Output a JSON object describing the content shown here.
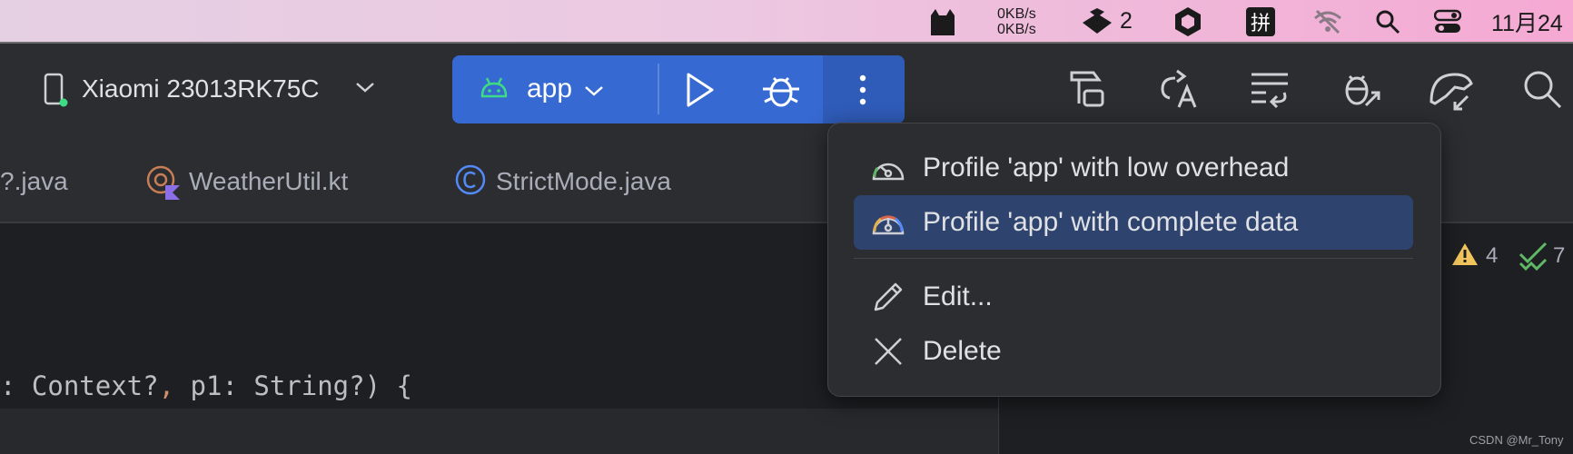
{
  "menubar": {
    "net_up": "0KB/s",
    "net_down": "0KB/s",
    "notif_count": "2",
    "input_method": "拼",
    "date": "11月24"
  },
  "toolbar": {
    "device_name": "Xiaomi 23013RK75C",
    "config_name": "app",
    "icons": [
      "device-icon",
      "chevron-down-icon",
      "android-icon",
      "run-icon",
      "debug-icon",
      "more-vertical-icon",
      "build-icon",
      "translate-icon",
      "sync-icon",
      "attach-debugger-icon",
      "profiler-icon",
      "search-icon"
    ]
  },
  "tabs": [
    {
      "label": "?.java",
      "icon": "java-class-icon"
    },
    {
      "label": "WeatherUtil.kt",
      "icon": "kotlin-file-icon"
    },
    {
      "label": "StrictMode.java",
      "icon": "java-class-icon"
    }
  ],
  "editor": {
    "code_line_before": ": Context?",
    "code_comma": ",",
    "code_line_after": " p1: String?) {"
  },
  "inspections": {
    "warnings": "4",
    "checks": "7"
  },
  "popup": {
    "items": [
      {
        "label": "Profile 'app' with low overhead",
        "icon": "gauge-low-icon",
        "selected": false
      },
      {
        "label": "Profile 'app' with complete data",
        "icon": "gauge-full-icon",
        "selected": true
      },
      {
        "label": "Edit...",
        "icon": "pencil-icon",
        "selected": false
      },
      {
        "label": "Delete",
        "icon": "close-icon",
        "selected": false
      }
    ]
  },
  "watermark": "CSDN @Mr_Tony",
  "colors": {
    "run_group": "#3669d1",
    "selected_item": "#2e436e",
    "android_green": "#3ddc84",
    "warning": "#f2c55c",
    "check": "#5fb865"
  }
}
